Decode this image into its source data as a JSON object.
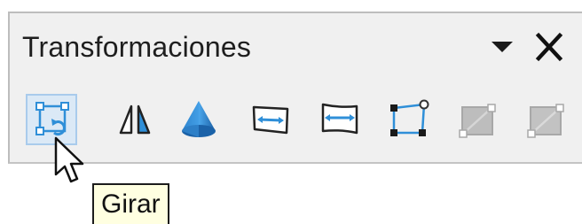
{
  "panel": {
    "title": "Transformaciones",
    "menu_icon": "dropdown-triangle-icon",
    "close_icon": "close-icon"
  },
  "toolbar": {
    "tools": [
      {
        "name": "rotate",
        "icon": "rotate-icon",
        "state": "hover"
      },
      {
        "name": "flip",
        "icon": "flip-icon",
        "state": "enabled"
      },
      {
        "name": "3d-object",
        "icon": "cone-3d-icon",
        "state": "enabled"
      },
      {
        "name": "set-in-circle-perspective",
        "icon": "perspective-circle-icon",
        "state": "enabled"
      },
      {
        "name": "set-in-circle-slant",
        "icon": "slant-circle-icon",
        "state": "enabled"
      },
      {
        "name": "distort",
        "icon": "distort-icon",
        "state": "enabled"
      },
      {
        "name": "gradient",
        "icon": "gradient-icon",
        "state": "disabled"
      },
      {
        "name": "transparency",
        "icon": "transparency-icon",
        "state": "disabled"
      }
    ]
  },
  "tooltip": {
    "text": "Girar"
  },
  "colors": {
    "panel_bg": "#f0f0f0",
    "active_bg": "#dbe9f6",
    "active_border": "#a9cbec",
    "accent_blue": "#2f8fd8",
    "tooltip_bg": "#ffffe1",
    "disabled_gray": "#b8b8b8"
  }
}
